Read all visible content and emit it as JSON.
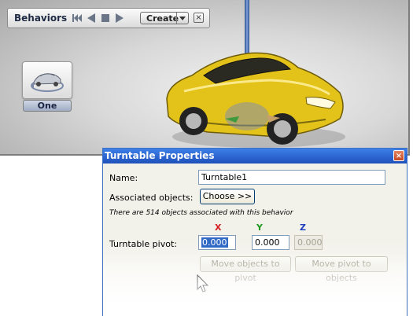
{
  "behaviors": {
    "title": "Behaviors",
    "create_label": "Create",
    "close_symbol": "×",
    "behavior_label": "One"
  },
  "dialog": {
    "title": "Turntable Properties",
    "close_symbol": "×",
    "name_label": "Name:",
    "name_value": "Turntable1",
    "associated_label": "Associated objects:",
    "choose_button": "Choose >>",
    "info_text": "There are 514 objects associated with this behavior",
    "axes": {
      "x": "X",
      "y": "Y",
      "z": "Z"
    },
    "pivot_label": "Turntable pivot:",
    "pivot_x": "0.000",
    "pivot_y": "0.000",
    "pivot_z": "0.000",
    "move_objects_button": "Move objects to pivot",
    "move_pivot_button": "Move pivot to objects"
  },
  "colors": {
    "axis_x": "#d32020",
    "axis_y": "#1e9a1e",
    "axis_z": "#2040c0",
    "titlebar": "#2b63cf",
    "car_body": "#e3c21a"
  }
}
